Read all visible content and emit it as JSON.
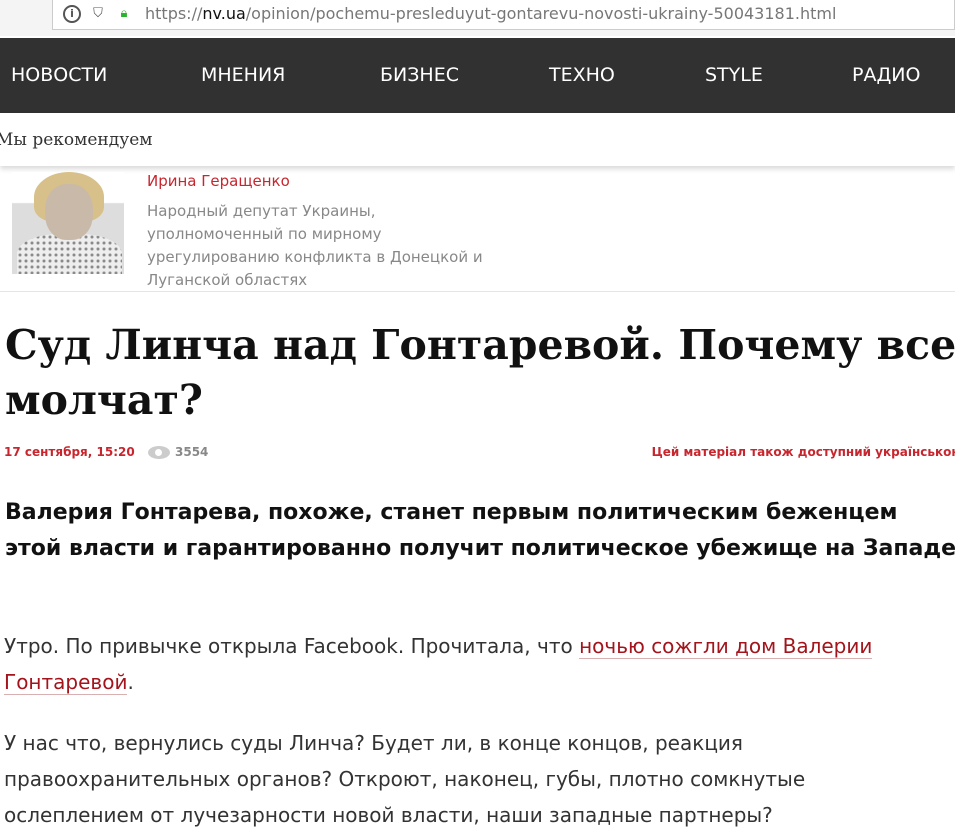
{
  "browser": {
    "url_prefix": "https://",
    "url_domain": "nv.ua",
    "url_path": "/opinion/pochemu-presleduyut-gontarevu-novosti-ukrainy-50043181.html"
  },
  "nav": [
    "НОВОСТИ",
    "МНЕНИЯ",
    "БИЗНЕС",
    "ТЕХНО",
    "STYLE",
    "РАДИО"
  ],
  "recommend": "Мы рекомендуем",
  "author": {
    "name": "Ирина Геращенко",
    "description": "Народный депутат Украины, уполномоченный по мирному урегулированию конфликта в Донецкой и Луганской областях"
  },
  "article": {
    "title": "Суд Линча над Гонтаревой. Почему все молчат?",
    "date": "17 сентября, 15:20",
    "views": "3554",
    "ua_link": "Цей матеріал також доступний українською",
    "lead": "Валерия Гонтарева, похоже, станет первым политическим беженцем этой власти и гарантированно получит политическое убежище на Западе",
    "p1_before": "Утро. По привычке открыла Facebook. Прочитала, что ",
    "p1_link": "ночью сожгли дом Валерии Гонтаревой",
    "p1_after": ".",
    "p2": "У нас что, вернулись суды Линча? Будет ли, в конце концов, реакция правоохранительных органов? Откроют, наконец, губы, плотно сомкнутые ослеплением от лучезарности новой власти, наши западные партнеры?"
  },
  "colors": {
    "accent": "#c8262e",
    "nav_bg": "#313131",
    "link": "#a3141c"
  }
}
